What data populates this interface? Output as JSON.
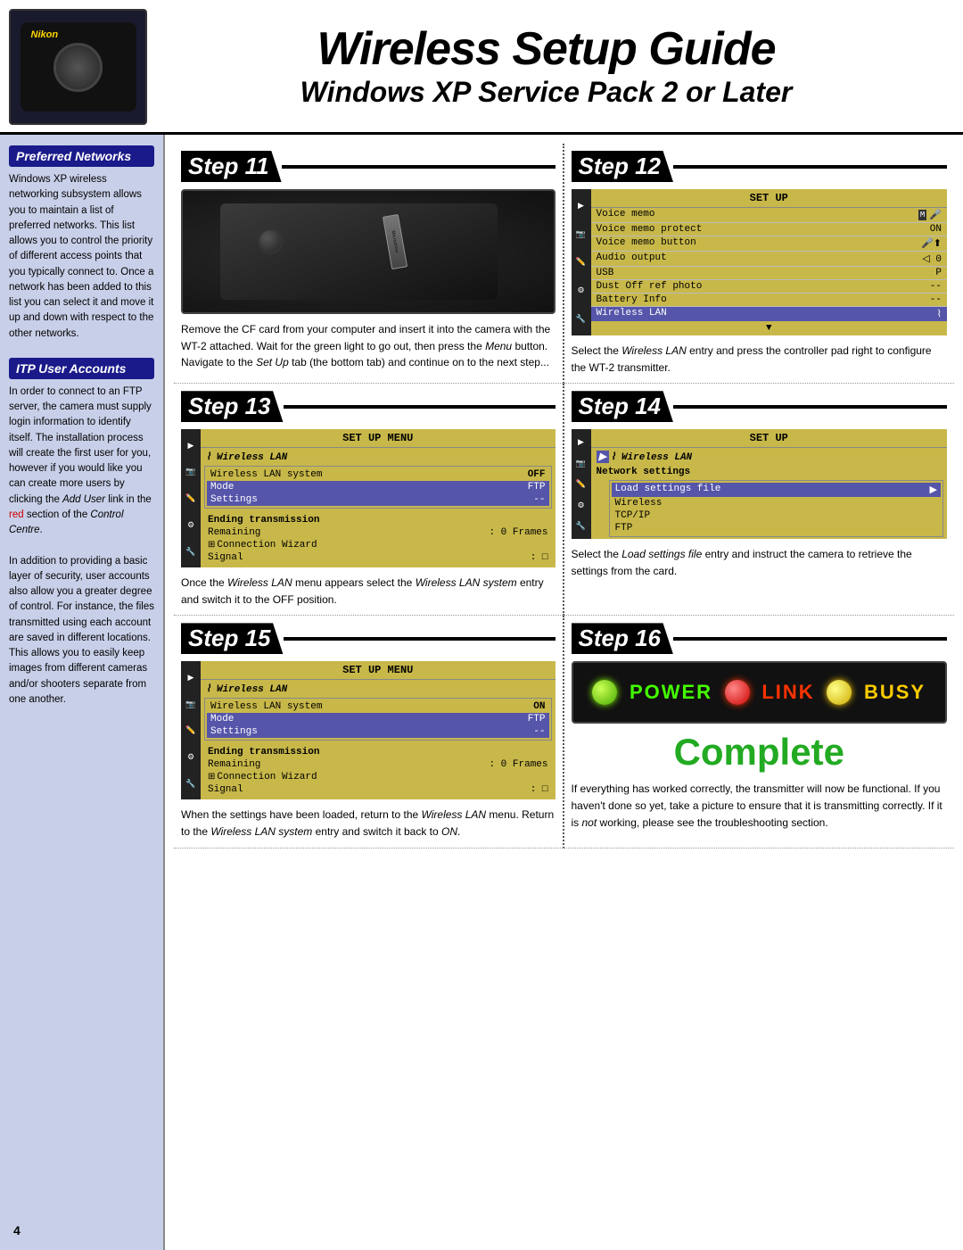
{
  "header": {
    "main_title": "Wireless Setup Guide",
    "sub_title": "Windows XP Service Pack 2 or Later",
    "camera_brand": "Nikon"
  },
  "sidebar": {
    "section1": {
      "title": "Preferred Networks",
      "text": "Windows XP wireless networking subsystem allows you to maintain a list of preferred networks. This list allows you to control the priority of different access points that you typically connect to. Once a network has been added to this list you can select it and move it up and down with respect to the other networks."
    },
    "section2": {
      "title": "ITP User Accounts",
      "text1": "In order to connect to an FTP server, the camera must supply login information to identify itself. The installation process will create the first user for you, however if you would like you can create more users by clicking the ",
      "add_user_link": "Add User",
      "text2": " link in the ",
      "red_text": "red",
      "text3": " section of the ",
      "control_centre": "Control Centre",
      "text4": ".",
      "text5": "In addition to providing a basic layer of security, user accounts also allow you a greater degree of control. For instance, the files transmitted using each account are saved in different locations. This allows you to easily keep images from different cameras and/or shooters separate from one another."
    }
  },
  "steps": {
    "step11": {
      "label": "Step 11",
      "description": "Remove the CF card from your computer and insert it into the camera with the WT-2 attached. Wait for the green light to go out, then press the Menu button. Navigate to the Set Up tab (the bottom tab) and continue on to the next step..."
    },
    "step12": {
      "label": "Step 12",
      "menu_title": "SET UP",
      "menu_items": [
        {
          "label": "Voice memo",
          "value": "",
          "selected": false
        },
        {
          "label": "Voice memo protect",
          "value": "ON",
          "selected": false
        },
        {
          "label": "Voice memo button",
          "value": "",
          "selected": false
        },
        {
          "label": "Audio output",
          "value": "0",
          "selected": false
        },
        {
          "label": "USB",
          "value": "P",
          "selected": false
        },
        {
          "label": "Dust Off ref photo",
          "value": "--",
          "selected": false
        },
        {
          "label": "Battery Info",
          "value": "--",
          "selected": false
        },
        {
          "label": "Wireless LAN",
          "value": "",
          "selected": true
        }
      ],
      "description": "Select the Wireless LAN entry and press the controller pad right to configure the WT-2 transmitter."
    },
    "step13": {
      "label": "Step 13",
      "menu_title": "SET UP MENU",
      "wlan_label": "Wireless LAN",
      "items": [
        {
          "label": "Wireless LAN system",
          "value": "OFF",
          "highlighted": false
        },
        {
          "label": "Mode",
          "value": "FTP",
          "highlighted": true
        },
        {
          "label": "Settings",
          "value": "--",
          "highlighted": true
        }
      ],
      "bottom_items": [
        {
          "label": "Ending transmission",
          "value": ""
        },
        {
          "label": "Remaining",
          "value": ": 0 Frames"
        },
        {
          "label": "Connection Wizard",
          "value": ""
        },
        {
          "label": "Signal",
          "value": ":"
        }
      ],
      "description": "Once the Wireless LAN menu appears select the Wireless LAN system entry and switch it to the OFF position."
    },
    "step14": {
      "label": "Step 14",
      "menu_title": "SET UP",
      "wlan_label": "Wireless LAN",
      "network_settings": "Network settings",
      "load_settings": "Load settings file",
      "items": [
        "Wireless",
        "TCP/IP",
        "FTP"
      ],
      "description": "Select the Load settings file entry and instruct the camera to retrieve the settings from the card."
    },
    "step15": {
      "label": "Step 15",
      "menu_title": "SET UP MENU",
      "wlan_label": "Wireless LAN",
      "items": [
        {
          "label": "Wireless LAN system",
          "value": "ON",
          "highlighted": false
        },
        {
          "label": "Mode",
          "value": "FTP",
          "highlighted": true
        },
        {
          "label": "Settings",
          "value": "--",
          "highlighted": true
        }
      ],
      "bottom_items": [
        {
          "label": "Ending transmission",
          "value": ""
        },
        {
          "label": "Remaining",
          "value": ": 0 Frames"
        },
        {
          "label": "Connection Wizard",
          "value": ""
        },
        {
          "label": "Signal",
          "value": ":"
        }
      ],
      "description1": "When the settings have been loaded, return to the ",
      "italic1": "Wireless LAN",
      "description2": " menu. Return to the ",
      "italic2": "Wireless LAN system",
      "description3": " entry and switch it back to ",
      "italic3": "ON",
      "description4": "."
    },
    "step16": {
      "label": "Step 16",
      "lights": [
        {
          "color": "green",
          "label": "POWER"
        },
        {
          "color": "red",
          "label": "LINK"
        },
        {
          "color": "yellow",
          "label": "BUSY"
        }
      ],
      "complete_text": "Complete",
      "description": "If everything has worked correctly, the transmitter will now be functional. If you haven't done so yet, take a picture to ensure that it is transmitting correctly. If it is not working, please see the troubleshooting section."
    }
  },
  "page_number": "4"
}
